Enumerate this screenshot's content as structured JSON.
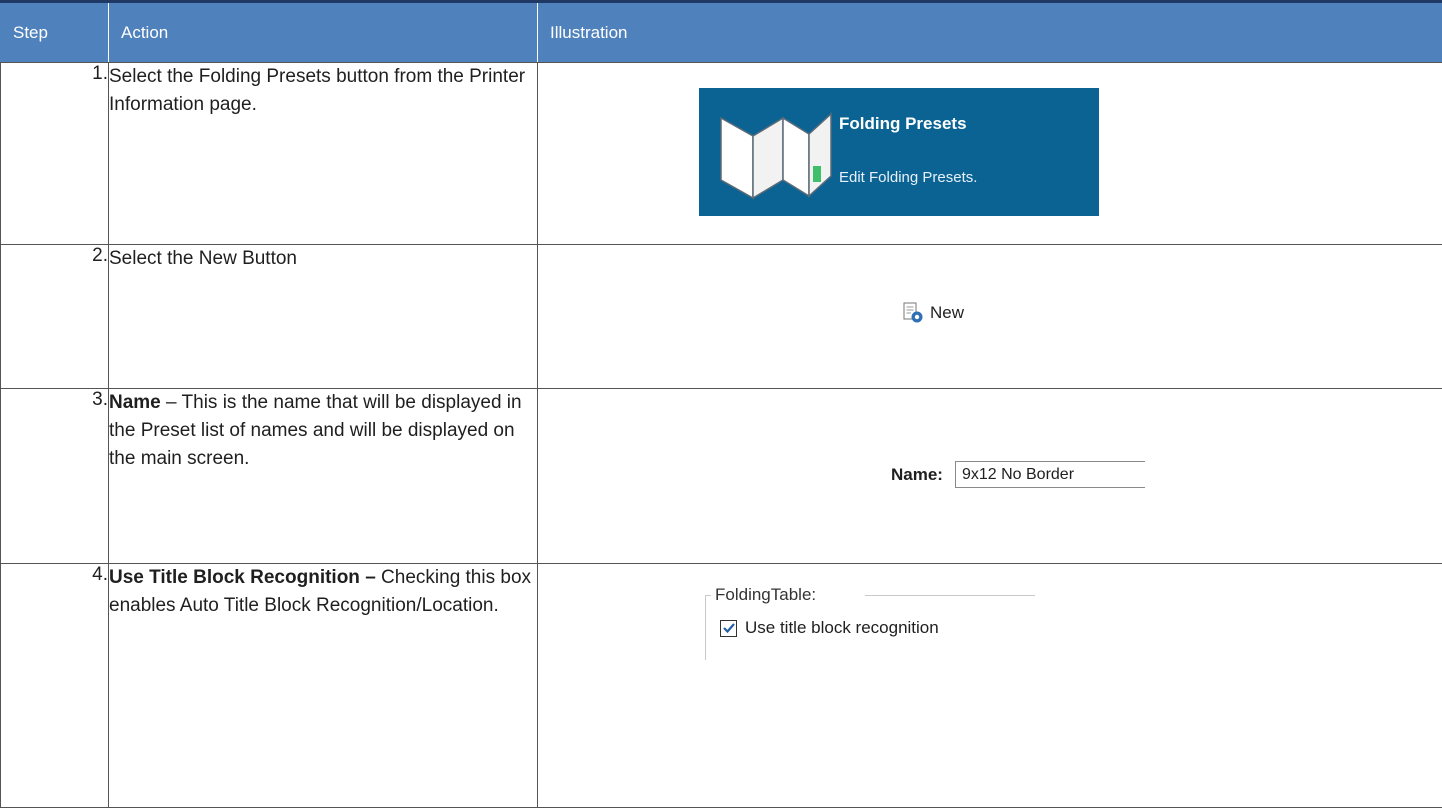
{
  "header": {
    "step": "Step",
    "action": "Action",
    "illustration": "Illustration"
  },
  "rows": [
    {
      "num": "1.",
      "action": "Select the Folding Presets button from the Printer Information page.",
      "illustration": {
        "title": "Folding Presets",
        "subtitle": "Edit Folding Presets."
      }
    },
    {
      "num": "2.",
      "action": "Select the New Button",
      "illustration": {
        "button_label": "New"
      }
    },
    {
      "num": "3.",
      "action_bold": "Name",
      "action_rest": " – This is the name that will be displayed in the Preset list of names and will be displayed on the main screen.",
      "illustration": {
        "label": "Name:",
        "value": "9x12 No Border"
      }
    },
    {
      "num": "4.",
      "action_bold": "Use Title Block Recognition –",
      "action_rest": " Checking this box enables Auto Title Block Recognition/Location.",
      "illustration": {
        "group_title": "FoldingTable:",
        "checkbox_label": "Use title block recognition",
        "checked": true
      }
    }
  ],
  "colors": {
    "header_bg": "#4f81bd",
    "tile_bg": "#0b6394"
  }
}
